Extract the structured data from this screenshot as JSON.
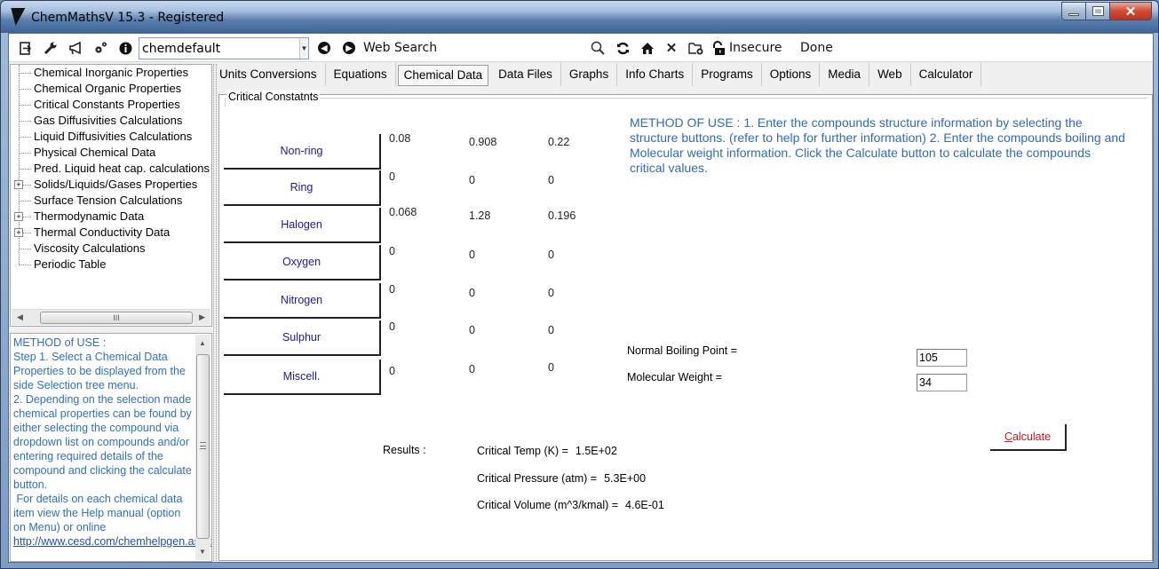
{
  "window": {
    "title": "ChemMathsV 15.3 - Registered",
    "controls": {
      "minimize": "minimize",
      "maximize": "maximize",
      "close": "close"
    }
  },
  "toolbar": {
    "icons": [
      "exit-icon",
      "wrench-icon",
      "megaphone-icon",
      "gears-icon",
      "info-icon"
    ],
    "profile_value": "chemdefault",
    "back_icon": "back-icon",
    "forward_icon": "forward-icon",
    "web_search_label": "Web Search",
    "nav_icons": [
      "zoom-icon",
      "refresh-icon",
      "home-icon",
      "stop-icon",
      "new-folder-icon",
      "unlock-icon"
    ],
    "security_label": "Insecure",
    "status_label": "Done"
  },
  "tree": {
    "items": [
      {
        "label": "Chemical Inorganic Properties",
        "expandable": false
      },
      {
        "label": "Chemical Organic Properties",
        "expandable": false
      },
      {
        "label": "Critical Constants Properties",
        "expandable": false
      },
      {
        "label": "Gas Diffusivities Calculations",
        "expandable": false
      },
      {
        "label": "Liquid Diffusivities Calculations",
        "expandable": false
      },
      {
        "label": "Physical Chemical Data",
        "expandable": false
      },
      {
        "label": "Pred. Liquid heat cap. calculations",
        "expandable": false
      },
      {
        "label": "Solids/Liquids/Gases Properties",
        "expandable": true
      },
      {
        "label": "Surface Tension Calculations",
        "expandable": false
      },
      {
        "label": "Thermodynamic Data",
        "expandable": true
      },
      {
        "label": "Thermal Conductivity Data",
        "expandable": true
      },
      {
        "label": "Viscosity Calculations",
        "expandable": false
      },
      {
        "label": "Periodic Table",
        "expandable": false
      }
    ],
    "scroll_thumb_grip": "III"
  },
  "help": {
    "text": "METHOD of USE :\nStep 1. Select a Chemical Data Properties to be displayed from the side Selection tree menu.\n2. Depending on the selection made chemical properties can be found by either selecting the compound via dropdown list on compounds and/or  entering required details of the compound and clicking the calculate button.\n For details on each chemical data item view the Help manual (option on Menu) or online ",
    "link": "http://www.cesd.com/chemhelpgen.aspx"
  },
  "tabs": [
    {
      "label": "Units Conversions",
      "active": false
    },
    {
      "label": "Equations",
      "active": false
    },
    {
      "label": "Chemical Data",
      "active": true
    },
    {
      "label": "Data Files",
      "active": false
    },
    {
      "label": "Graphs",
      "active": false
    },
    {
      "label": "Info Charts",
      "active": false
    },
    {
      "label": "Programs",
      "active": false
    },
    {
      "label": "Options",
      "active": false
    },
    {
      "label": "Media",
      "active": false
    },
    {
      "label": "Web",
      "active": false
    },
    {
      "label": "Calculator",
      "active": false
    }
  ],
  "panel": {
    "group_title": "Critical Constatnts",
    "structures": [
      {
        "label": "Non-ring",
        "values": [
          "0.08",
          "0.908",
          "0.22"
        ]
      },
      {
        "label": "Ring",
        "values": [
          "0",
          "0",
          "0"
        ]
      },
      {
        "label": "Halogen",
        "values": [
          "0.068",
          "1.28",
          "0.196"
        ]
      },
      {
        "label": "Oxygen",
        "values": [
          "0",
          "0",
          "0"
        ]
      },
      {
        "label": "Nitrogen",
        "values": [
          "0",
          "0",
          "0"
        ]
      },
      {
        "label": "Sulphur",
        "values": [
          "0",
          "0",
          "0"
        ]
      },
      {
        "label": "Miscell.",
        "values": [
          "0",
          "0",
          "0"
        ]
      }
    ],
    "method_text": "METHOD OF USE : 1. Enter the compounds structure information by selecting the structure buttons. (refer to help for further information)  2. Enter the compounds boiling and Molecular weight information. Click the Calculate button to calculate the compounds critical values.",
    "boiling_point_label": "Normal Boiling Point =",
    "boiling_point_value": "105",
    "mol_weight_label": "Molecular Weight =",
    "mol_weight_value": "34",
    "calculate_first": "C",
    "calculate_rest": "alculate",
    "results_label": "Results :",
    "results": [
      {
        "label": "Critical Temp (K) =",
        "value": "1.5E+02"
      },
      {
        "label": "Critical Pressure (atm) =",
        "value": "5.3E+00"
      },
      {
        "label": "Critical Volume (m^3/kmal) =",
        "value": "4.6E-01"
      }
    ],
    "accent_color": "#2e6bb7",
    "button_text_color": "#1a1a9c",
    "calculate_color": "#d0101a"
  }
}
